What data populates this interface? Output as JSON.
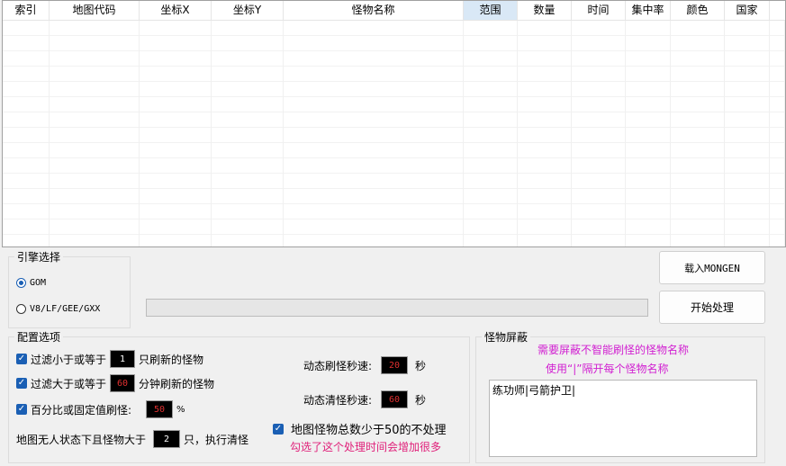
{
  "table": {
    "columns": [
      "索引",
      "地图代码",
      "坐标X",
      "坐标Y",
      "怪物名称",
      "范围",
      "数量",
      "时间",
      "集中率",
      "颜色",
      "国家"
    ],
    "selected_column": "范围"
  },
  "engine": {
    "title": "引擎选择",
    "options": [
      "GOM",
      "V8/LF/GEE/GXX"
    ],
    "selected": "GOM"
  },
  "buttons": {
    "load": "载入MONGEN",
    "start": "开始处理"
  },
  "config": {
    "title": "配置选项",
    "filter_small": {
      "prefix": "过滤小于或等于",
      "value": "1",
      "suffix": "只刷新的怪物",
      "checked": true
    },
    "filter_large": {
      "prefix": "过滤大于或等于",
      "value": "60",
      "suffix": "分钟刷新的怪物",
      "checked": true
    },
    "percent": {
      "prefix": "百分比或固定值刷怪:",
      "value": "50",
      "suffix": "%",
      "checked": true
    },
    "clear": {
      "prefix": "地图无人状态下且怪物大于",
      "value": "2",
      "suffix": "只，执行清怪"
    },
    "dyn_refresh": {
      "label": "动态刷怪秒速:",
      "value": "20",
      "unit": "秒"
    },
    "dyn_clear": {
      "label": "动态清怪秒速:",
      "value": "60",
      "unit": "秒"
    },
    "skip_small": {
      "label": "地图怪物总数少于50的不处理",
      "checked": true
    },
    "warning": "勾选了这个处理时间会增加很多"
  },
  "shield": {
    "title": "怪物屏蔽",
    "hint1": "需要屏蔽不智能刷怪的怪物名称",
    "hint2": "使用“|”隔开每个怪物名称",
    "value": "练功师|弓箭护卫|"
  },
  "colors": {
    "accent": "#1a5fb4",
    "warning": "#e0207a",
    "hint": "#d11fd1"
  }
}
